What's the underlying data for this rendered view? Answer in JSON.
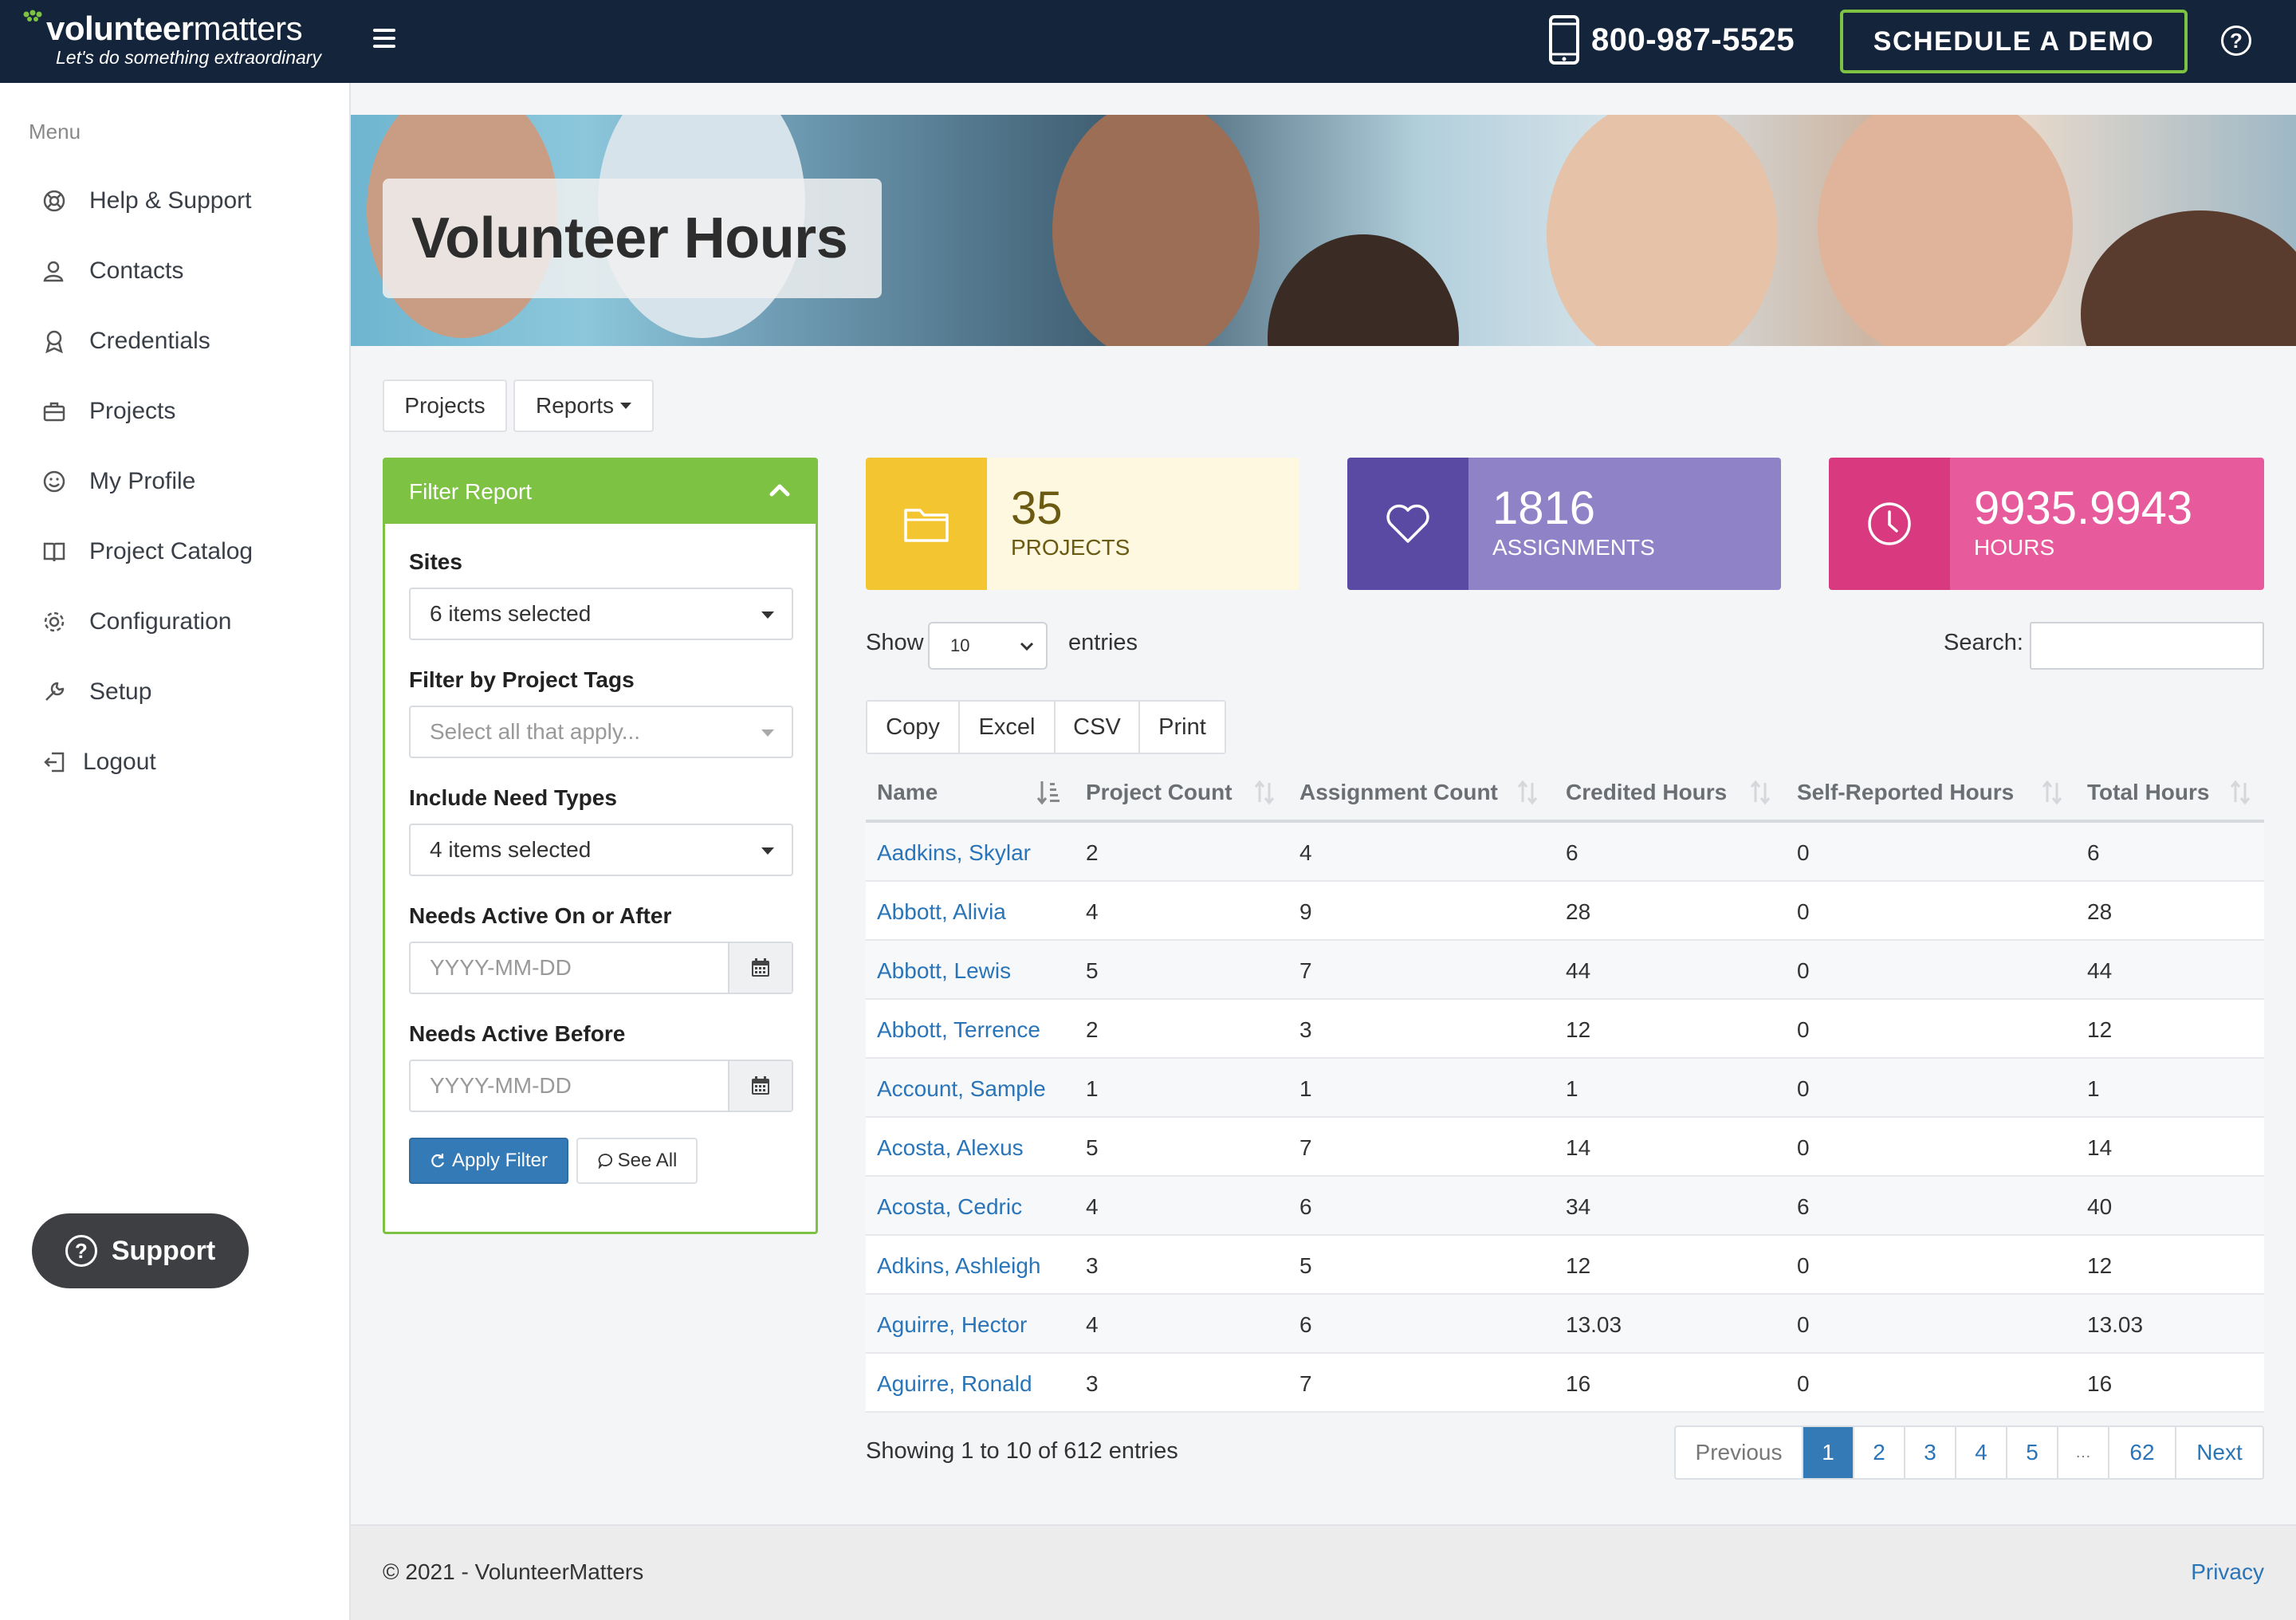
{
  "header": {
    "brand_bold": "volunteer",
    "brand_thin": "matters",
    "tagline": "Let's do something extraordinary",
    "phone": "800-987-5525",
    "demo_label": "SCHEDULE A DEMO",
    "help_glyph": "?"
  },
  "sidebar": {
    "menu_label": "Menu",
    "items": [
      {
        "label": "Help & Support",
        "icon": "lifebuoy-icon"
      },
      {
        "label": "Contacts",
        "icon": "contacts-icon"
      },
      {
        "label": "Credentials",
        "icon": "award-icon"
      },
      {
        "label": "Projects",
        "icon": "briefcase-icon"
      },
      {
        "label": "My Profile",
        "icon": "smiley-icon"
      },
      {
        "label": "Project Catalog",
        "icon": "book-icon"
      },
      {
        "label": "Configuration",
        "icon": "gear-icon"
      },
      {
        "label": "Setup",
        "icon": "wrench-icon"
      },
      {
        "label": "Logout",
        "icon": "logout-icon"
      }
    ],
    "support_label": "Support"
  },
  "banner": {
    "title": "Volunteer Hours"
  },
  "tabs": {
    "projects": "Projects",
    "reports": "Reports"
  },
  "filter": {
    "title": "Filter Report",
    "sites_label": "Sites",
    "sites_value": "6 items selected",
    "tags_label": "Filter by Project Tags",
    "tags_placeholder": "Select all that apply...",
    "need_types_label": "Include Need Types",
    "need_types_value": "4 items selected",
    "active_after_label": "Needs Active On or After",
    "active_after_placeholder": "YYYY-MM-DD",
    "active_before_label": "Needs Active Before",
    "active_before_placeholder": "YYYY-MM-DD",
    "apply_label": "Apply Filter",
    "see_all_label": "See All"
  },
  "stats": {
    "projects": {
      "value": "35",
      "label": "PROJECTS",
      "color": "#f2c531",
      "bg": "#fdf8df",
      "text": "#6a5a12"
    },
    "assignments": {
      "value": "1816",
      "label": "ASSIGNMENTS",
      "color": "#5a4aa3",
      "bg": "#8f82c7",
      "text": "#ffffff"
    },
    "hours": {
      "value": "9935.9943",
      "label": "HOURS",
      "color": "#d8397f",
      "bg": "#e75b9c",
      "text": "#ffffff"
    }
  },
  "table_controls": {
    "show_label": "Show",
    "page_size": "10",
    "entries_label": "entries",
    "search_label": "Search:",
    "search_value": "",
    "export_buttons": [
      "Copy",
      "Excel",
      "CSV",
      "Print"
    ]
  },
  "table": {
    "columns": [
      "Name",
      "Project Count",
      "Assignment Count",
      "Credited Hours",
      "Self-Reported Hours",
      "Total Hours"
    ],
    "rows": [
      [
        "Aadkins, Skylar",
        "2",
        "4",
        "6",
        "0",
        "6"
      ],
      [
        "Abbott, Alivia",
        "4",
        "9",
        "28",
        "0",
        "28"
      ],
      [
        "Abbott, Lewis",
        "5",
        "7",
        "44",
        "0",
        "44"
      ],
      [
        "Abbott, Terrence",
        "2",
        "3",
        "12",
        "0",
        "12"
      ],
      [
        "Account, Sample",
        "1",
        "1",
        "1",
        "0",
        "1"
      ],
      [
        "Acosta, Alexus",
        "5",
        "7",
        "14",
        "0",
        "14"
      ],
      [
        "Acosta, Cedric",
        "4",
        "6",
        "34",
        "6",
        "40"
      ],
      [
        "Adkins, Ashleigh",
        "3",
        "5",
        "12",
        "0",
        "12"
      ],
      [
        "Aguirre, Hector",
        "4",
        "6",
        "13.03",
        "0",
        "13.03"
      ],
      [
        "Aguirre, Ronald",
        "3",
        "7",
        "16",
        "0",
        "16"
      ]
    ]
  },
  "pagination": {
    "summary": "Showing 1 to 10 of 612 entries",
    "previous": "Previous",
    "pages": [
      "1",
      "2",
      "3",
      "4",
      "5",
      "…",
      "62"
    ],
    "active": "1",
    "next": "Next"
  },
  "footer": {
    "copyright": "© 2021 - VolunteerMatters",
    "privacy": "Privacy"
  }
}
